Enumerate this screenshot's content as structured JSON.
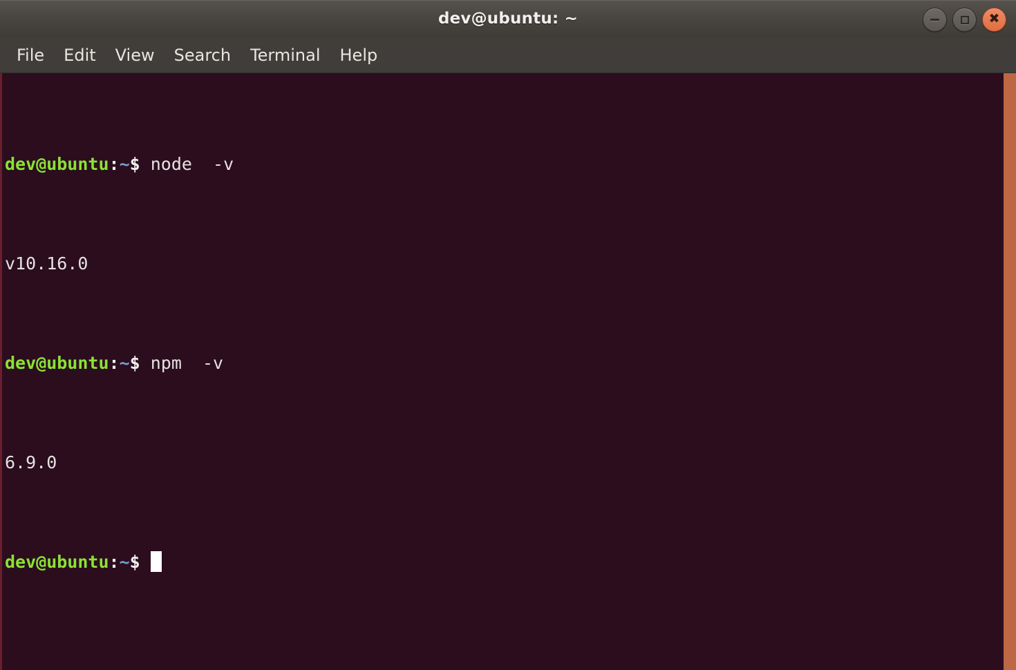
{
  "window": {
    "title": "dev@ubuntu: ~",
    "controls": [
      {
        "name": "minimize",
        "label": "–",
        "glyph": "minimize-icon"
      },
      {
        "name": "maximize",
        "label": "□",
        "glyph": "maximize-icon"
      },
      {
        "name": "close",
        "label": "✕",
        "glyph": "close-icon"
      }
    ]
  },
  "menubar": {
    "items": [
      {
        "label": "File"
      },
      {
        "label": "Edit"
      },
      {
        "label": "View"
      },
      {
        "label": "Search"
      },
      {
        "label": "Terminal"
      },
      {
        "label": "Help"
      }
    ]
  },
  "terminal": {
    "prompt": {
      "user_host": "dev@ubuntu",
      "colon": ":",
      "path": "~",
      "symbol": "$"
    },
    "lines": [
      {
        "type": "command",
        "command": "node  -v"
      },
      {
        "type": "output",
        "text": "v10.16.0"
      },
      {
        "type": "command",
        "command": "npm  -v"
      },
      {
        "type": "output",
        "text": "6.9.0"
      },
      {
        "type": "command",
        "command": ""
      }
    ],
    "cursor_visible": true
  },
  "colors": {
    "terminal_background": "#2b0d1e",
    "titlebar_top": "#56524e",
    "titlebar_bottom": "#3e3b37",
    "menubar_background": "#403d3a",
    "prompt_green": "#8ae234",
    "prompt_blue": "#729fcf",
    "foreground": "#e6e2e0",
    "close_button": "#df6e43",
    "window_edge": "#bd6744",
    "left_edge": "#6b1f2e"
  }
}
